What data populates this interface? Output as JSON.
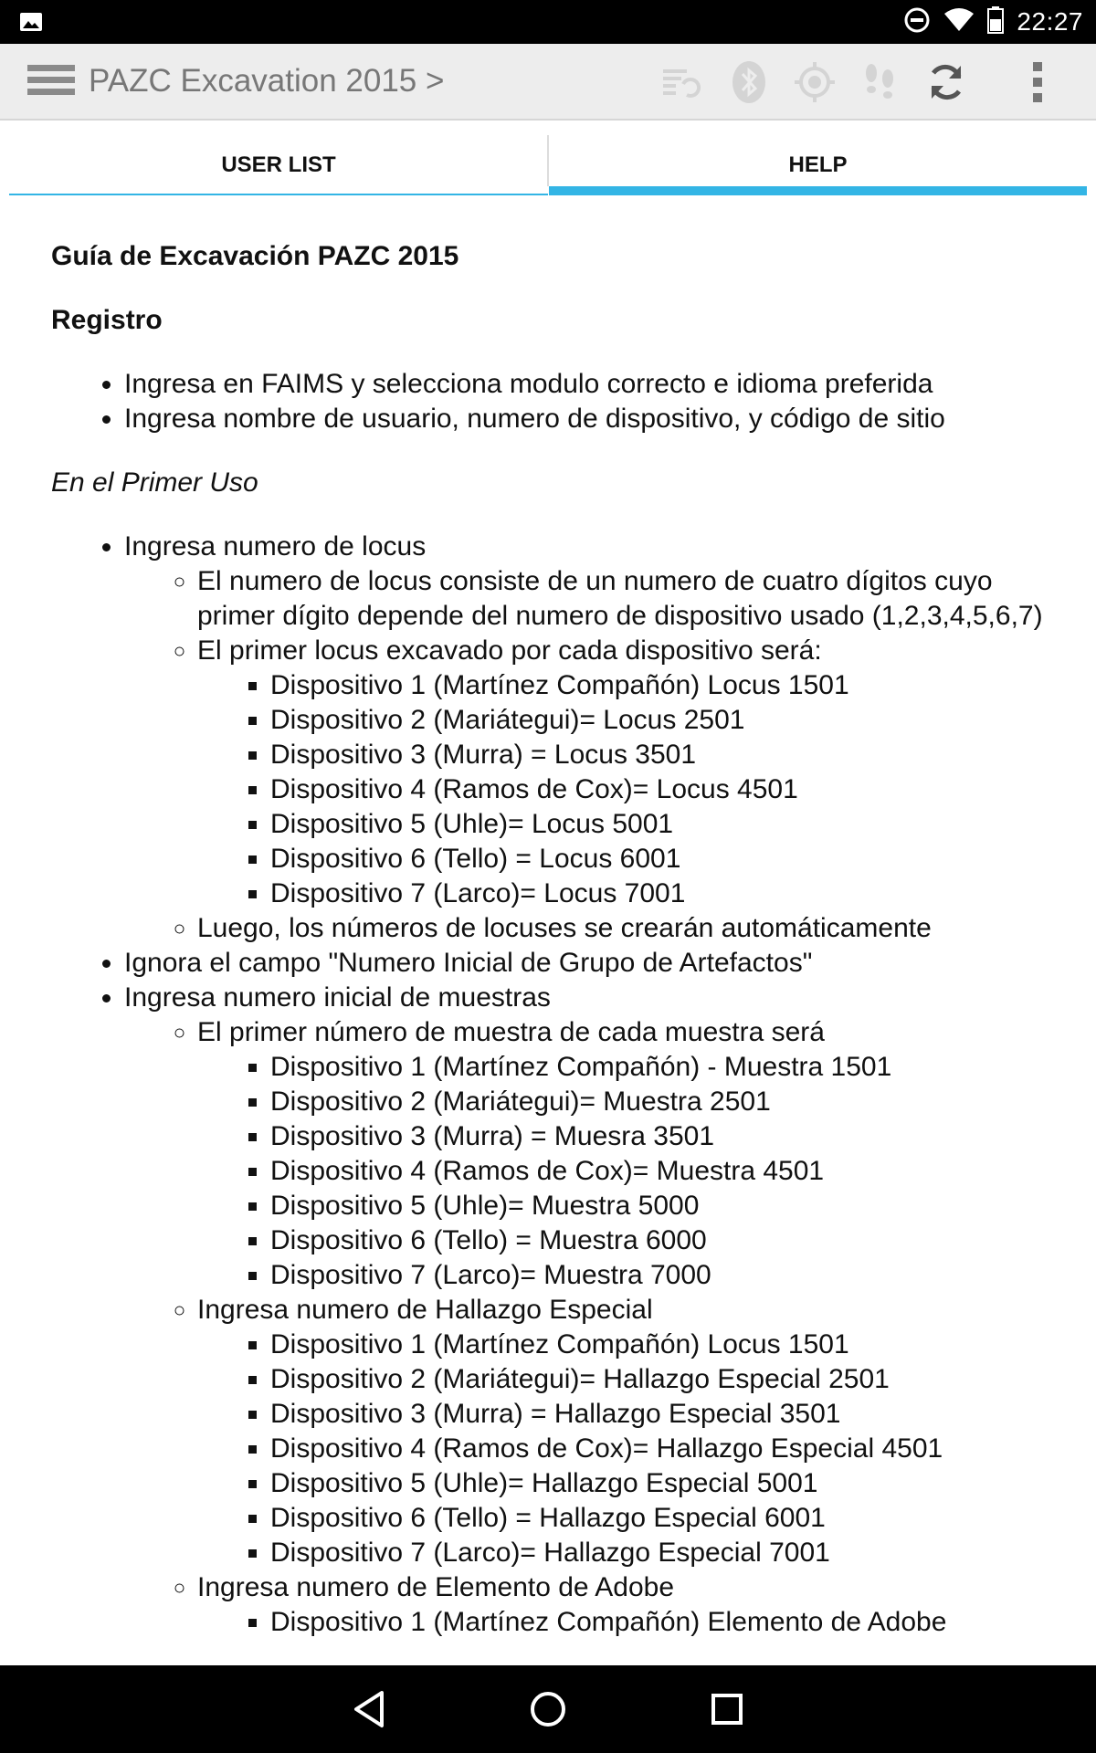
{
  "status_bar": {
    "time": "22:27"
  },
  "app_bar": {
    "title": "PAZC Excavation 2015 >"
  },
  "tabs": [
    {
      "label": "USER LIST",
      "selected": false
    },
    {
      "label": "HELP",
      "selected": true
    }
  ],
  "help": {
    "title": "Guía de Excavación PAZC 2015",
    "registro_heading": "Registro",
    "registro_items": [
      "Ingresa en FAIMS y selecciona modulo correcto e idioma preferida",
      "Ingresa nombre de usuario, numero de dispositivo, y código de sitio"
    ],
    "primer_uso_heading": "En el Primer Uso",
    "locus": {
      "label": "Ingresa numero de locus",
      "desc": "El numero de locus consiste de un numero de cuatro dígitos cuyo primer dígito depende del numero de dispositivo usado (1,2,3,4,5,6,7)",
      "first_label": "El primer locus excavado por cada dispositivo será:",
      "devices": [
        "Dispositivo 1 (Martínez Compañón) Locus 1501",
        "Dispositivo 2 (Mariátegui)= Locus 2501",
        "Dispositivo 3 (Murra) = Locus 3501",
        "Dispositivo 4 (Ramos de Cox)= Locus 4501",
        "Dispositivo 5 (Uhle)= Locus 5001",
        "Dispositivo 6 (Tello) = Locus 6001",
        "Dispositivo 7 (Larco)= Locus 7001"
      ],
      "after": "Luego, los números de locuses se crearán automáticamente"
    },
    "ignore_item": "Ignora el campo \"Numero Inicial de Grupo de Artefactos\"",
    "muestras": {
      "label": "Ingresa numero inicial de muestras",
      "first_label": "El primer número de muestra de cada muestra será",
      "devices": [
        "Dispositivo 1 (Martínez Compañón) - Muestra 1501",
        "Dispositivo 2 (Mariátegui)= Muestra 2501",
        "Dispositivo 3 (Murra) = Muesra 3501",
        "Dispositivo 4 (Ramos de Cox)= Muestra 4501",
        "Dispositivo 5 (Uhle)= Muestra 5000",
        "Dispositivo 6 (Tello) = Muestra 6000",
        "Dispositivo 7 (Larco)= Muestra 7000"
      ],
      "hallazgo_label": "Ingresa numero de Hallazgo Especial",
      "hallazgo_devices": [
        "Dispositivo 1 (Martínez Compañón) Locus 1501",
        "Dispositivo 2 (Mariátegui)= Hallazgo Especial 2501",
        "Dispositivo 3 (Murra) = Hallazgo Especial 3501",
        "Dispositivo 4 (Ramos de Cox)= Hallazgo Especial 4501",
        "Dispositivo 5 (Uhle)= Hallazgo Especial 5001",
        "Dispositivo 6 (Tello) = Hallazgo Especial 6001",
        "Dispositivo 7 (Larco)= Hallazgo Especial 7001"
      ],
      "adobe_label": "Ingresa numero de Elemento de Adobe",
      "adobe_devices": [
        "Dispositivo 1 (Martínez Compañón) Elemento de Adobe"
      ]
    }
  }
}
